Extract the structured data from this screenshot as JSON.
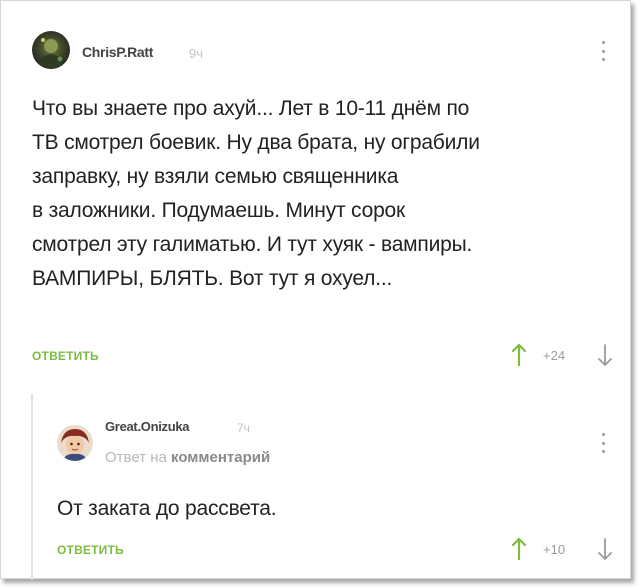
{
  "comment": {
    "author": "ChrisP.Ratt",
    "time": "9ч",
    "lines": [
      "Что вы знаете про ахуй... Лет в 10-11 днём по",
      "ТВ смотрел боевик. Ну два брата, ну ограбили",
      "заправку, ну взяли семью священника",
      "в заложники. Подумаешь. Минут сорок",
      "смотрел эту галиматью. И тут хуяк - вампиры.",
      "ВАМПИРЫ, БЛЯТЬ. Вот тут я охуел..."
    ],
    "reply_label": "ОТВЕТИТЬ",
    "rating": "+24"
  },
  "reply": {
    "author": "Great.Onizuka",
    "time": "7ч",
    "reply_to_prefix": "Ответ на",
    "reply_to_link": "комментарий",
    "text": "От заката до рассвета.",
    "reply_label": "ОТВЕТИТЬ",
    "rating": "+10"
  },
  "icons": {
    "upvote": "arrow-up-icon",
    "downvote": "arrow-down-icon",
    "menu": "kebab-menu-icon"
  },
  "colors": {
    "accent_green": "#7cbd3f",
    "text": "#222222",
    "muted": "#9b9b9b"
  }
}
